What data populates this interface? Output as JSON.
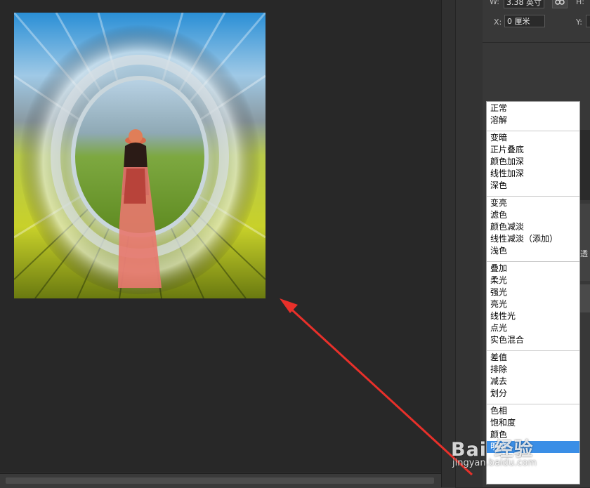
{
  "properties": {
    "w_label": "W:",
    "w_value": "3.38 英寸",
    "h_label": "H:",
    "x_label": "X:",
    "x_value": "0 厘米",
    "y_label": "Y:",
    "link_icon": "link-icon"
  },
  "layers_panel": {
    "partial_label": "透"
  },
  "blend_mode_menu": {
    "groups": [
      [
        "正常",
        "溶解"
      ],
      [
        "变暗",
        "正片叠底",
        "颜色加深",
        "线性加深",
        "深色"
      ],
      [
        "变亮",
        "滤色",
        "颜色减淡",
        "线性减淡（添加）",
        "浅色"
      ],
      [
        "叠加",
        "柔光",
        "强光",
        "亮光",
        "线性光",
        "点光",
        "实色混合"
      ],
      [
        "差值",
        "排除",
        "减去",
        "划分"
      ],
      [
        "色相",
        "饱和度",
        "颜色",
        "明度"
      ]
    ],
    "selected": "明度"
  },
  "watermark": {
    "logo": "Bai 经验",
    "url": "jingyan.baidu.com"
  },
  "colors": {
    "accent_selected": "#3a8ee6",
    "arrow": "#e8302a"
  }
}
